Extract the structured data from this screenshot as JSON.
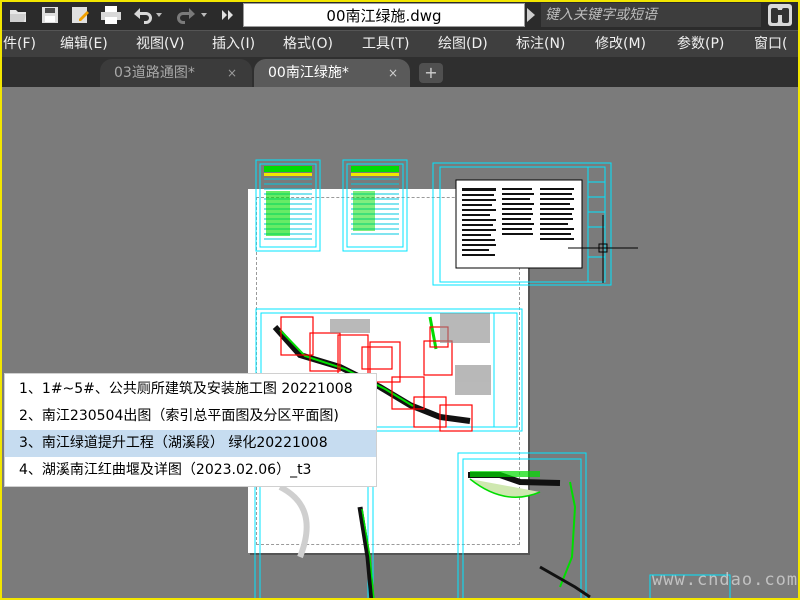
{
  "title": {
    "filename": "00南江绿施.dwg",
    "search_placeholder": "键入关键字或短语"
  },
  "quick_access": [
    "open-folder-icon",
    "save-icon",
    "save-as-icon",
    "print-icon",
    "undo-icon",
    "redo-icon",
    "more-icon"
  ],
  "menu": {
    "items": [
      "件(F)",
      "编辑(E)",
      "视图(V)",
      "插入(I)",
      "格式(O)",
      "工具(T)",
      "绘图(D)",
      "标注(N)",
      "修改(M)",
      "参数(P)",
      "窗口("
    ]
  },
  "tabs": [
    {
      "label": "03道路通图*",
      "close": "×",
      "active": false
    },
    {
      "label": "00南江绿施*",
      "close": "×",
      "active": true
    }
  ],
  "tab_add": "+",
  "recent_files": [
    {
      "label": "1、1#~5#、公共厕所建筑及安装施工图 20221008",
      "selected": false
    },
    {
      "label": "2、南江230504出图（索引总平面图及分区平面图)",
      "selected": false
    },
    {
      "label": "3、南江绿道提升工程（湖溪段） 绿化20221008",
      "selected": true
    },
    {
      "label": "4、湖溪南江红曲堰及详图（2023.02.06）_t3",
      "selected": false
    }
  ],
  "watermark": "www.cndao.com",
  "colors": {
    "accent_frame": "#f2e600",
    "drawing_cyan": "#00e5ff",
    "drawing_red": "#ff0000",
    "drawing_green": "#00dd00",
    "selection": "#c6dcf0"
  }
}
